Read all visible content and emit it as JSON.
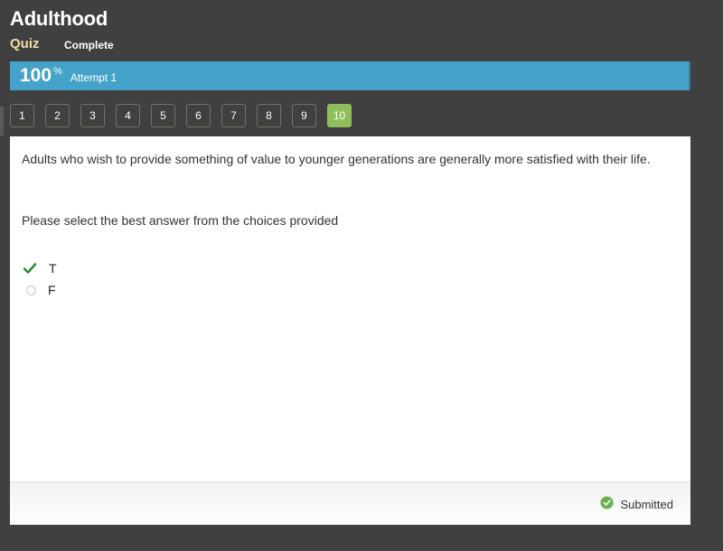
{
  "header": {
    "title": "Adulthood",
    "type_label": "Quiz",
    "status_label": "Complete"
  },
  "progress": {
    "value": 100,
    "value_text": "100",
    "percent_sign": "%",
    "attempt_label": "Attempt 1",
    "color": "#45a3c9"
  },
  "question_nav": {
    "items": [
      "1",
      "2",
      "3",
      "4",
      "5",
      "6",
      "7",
      "8",
      "9",
      "10"
    ],
    "active_index": 9,
    "active_color": "#8fbf5a"
  },
  "question": {
    "text": "Adults who wish to provide something of value to younger generations are generally more satisfied with their life.",
    "instruction": "Please select the best answer from the choices provided",
    "choices": [
      {
        "label": "T",
        "state": "correct-selected",
        "icon": "checkmark-icon"
      },
      {
        "label": "F",
        "state": "unselected",
        "icon": "radio-empty-icon"
      }
    ]
  },
  "footer": {
    "status_text": "Submitted",
    "status_icon": "check-circle-icon",
    "status_color": "#6ab04c"
  }
}
